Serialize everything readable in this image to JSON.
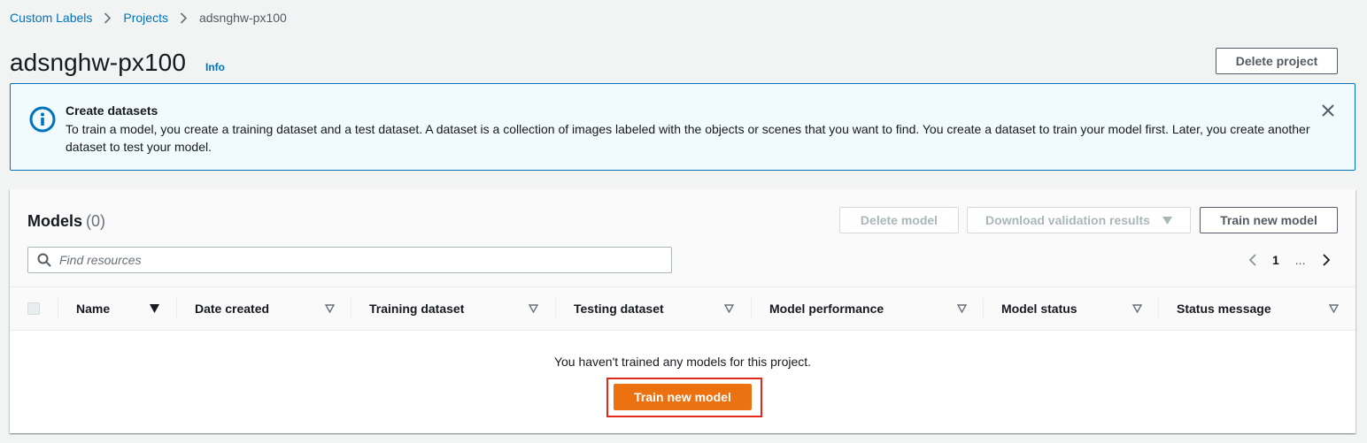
{
  "breadcrumb": {
    "items": [
      "Custom Labels",
      "Projects"
    ],
    "current": "adsnghw-px100"
  },
  "header": {
    "title": "adsnghw-px100",
    "info_label": "Info",
    "delete_project_label": "Delete project"
  },
  "alert": {
    "title": "Create datasets",
    "body": "To train a model, you create a training dataset and a test dataset. A dataset is a collection of images labeled with the objects or scenes that you want to find. You create a dataset to train your model first. Later, you create another dataset to test your model.",
    "icon": "info-circle-icon"
  },
  "models": {
    "title": "Models",
    "count": "(0)",
    "delete_model_label": "Delete model",
    "download_label": "Download validation results",
    "train_label": "Train new model",
    "search_placeholder": "Find resources",
    "pagination": {
      "current_page": "1",
      "ellipsis": "..."
    },
    "columns": [
      "Name",
      "Date created",
      "Training dataset",
      "Testing dataset",
      "Model performance",
      "Model status",
      "Status message"
    ],
    "empty_message": "You haven't trained any models for this project.",
    "empty_action_label": "Train new model"
  },
  "colors": {
    "link": "#0073bb",
    "primary_button": "#ec7211",
    "highlight": "#e3291c",
    "alert_bg": "#f1faff"
  }
}
